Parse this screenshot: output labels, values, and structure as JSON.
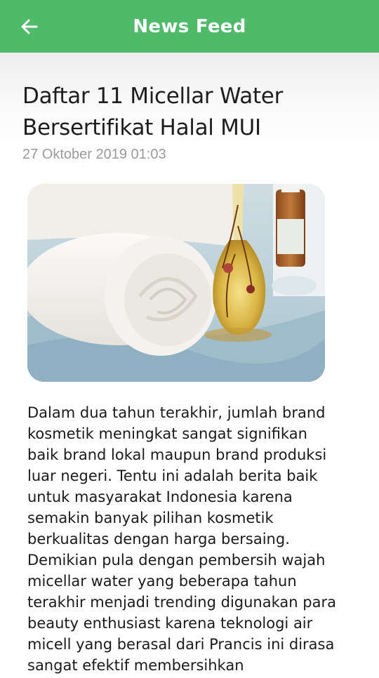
{
  "header": {
    "back_label": "back",
    "title": "News Feed",
    "color": "#4fba6a"
  },
  "article": {
    "title": "Daftar 11 Micellar Water Bersertifikat Halal MUI",
    "date": "27 Oktober 2019 01:03",
    "image_subject": "rolled white towels beside oil bottle with dried flowers",
    "body": "Dalam dua tahun terakhir, jumlah brand kosmetik meningkat sangat signifikan baik brand lokal maupun brand produksi luar negeri. Tentu ini adalah berita baik untuk masyarakat Indonesia karena semakin banyak pilihan kosmetik berkualitas dengan harga bersaing. Demikian pula dengan pembersih wajah micellar water yang beberapa tahun terakhir menjadi trending digunakan para beauty enthusiast karena teknologi air micell yang berasal dari Prancis ini dirasa sangat efektif membersihkan"
  }
}
